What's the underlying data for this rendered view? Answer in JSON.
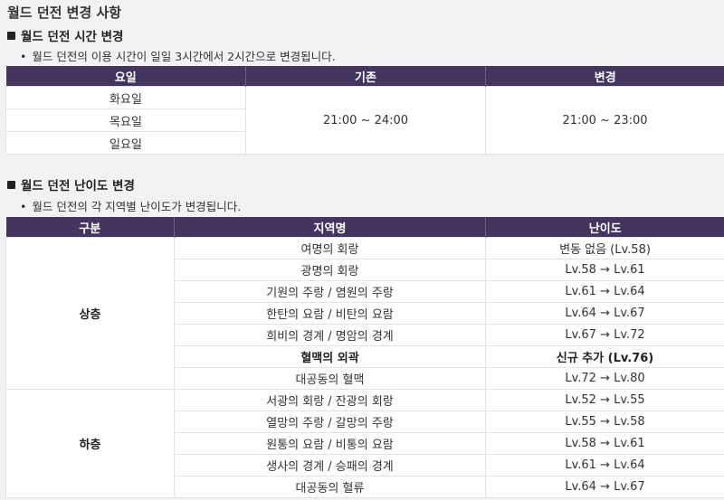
{
  "page_title": "월드 던전 변경 사항",
  "section1": {
    "title": "월드 던전 시간 변경",
    "bullet": "월드 던전의 이용 시간이 일일 3시간에서 2시간으로 변경됩니다.",
    "headers": [
      "요일",
      "기존",
      "변경"
    ],
    "days": [
      "화요일",
      "목요일",
      "일요일"
    ],
    "before": "21:00 ~ 24:00",
    "after": "21:00 ~ 23:00"
  },
  "section2": {
    "title": "월드 던전 난이도 변경",
    "bullet": "월드 던전의 각 지역별 난이도가 변경됩니다.",
    "headers": [
      "구분",
      "지역명",
      "난이도"
    ],
    "groups": [
      {
        "name": "상층",
        "rows": [
          {
            "area": "여명의 회랑",
            "level": "변동 없음 (Lv.58)"
          },
          {
            "area": "광명의 회랑",
            "level": "Lv.58 → Lv.61"
          },
          {
            "area": "기원의 주랑 / 염원의 주랑",
            "level": "Lv.61 → Lv.64"
          },
          {
            "area": "한탄의 요람 / 비탄의 요람",
            "level": "Lv.64 → Lv.67"
          },
          {
            "area": "희비의 경계 / 명암의 경계",
            "level": "Lv.67 → Lv.72"
          },
          {
            "area": "혈맥의 외곽",
            "level": "신규 추가 (Lv.76)",
            "bold": true
          },
          {
            "area": "대공동의 혈맥",
            "level": "Lv.72 → Lv.80"
          }
        ]
      },
      {
        "name": "하층",
        "rows": [
          {
            "area": "서광의 회랑 / 잔광의 회랑",
            "level": "Lv.52 → Lv.55"
          },
          {
            "area": "열망의 주랑 / 갈망의 주랑",
            "level": "Lv.55 → Lv.58"
          },
          {
            "area": "원통의 요람 / 비통의 요람",
            "level": "Lv.58 → Lv.61"
          },
          {
            "area": "생사의 경계 / 승패의 경계",
            "level": "Lv.61 → Lv.64"
          },
          {
            "area": "대공동의 혈류",
            "level": "Lv.64 → Lv.67"
          }
        ]
      }
    ]
  }
}
